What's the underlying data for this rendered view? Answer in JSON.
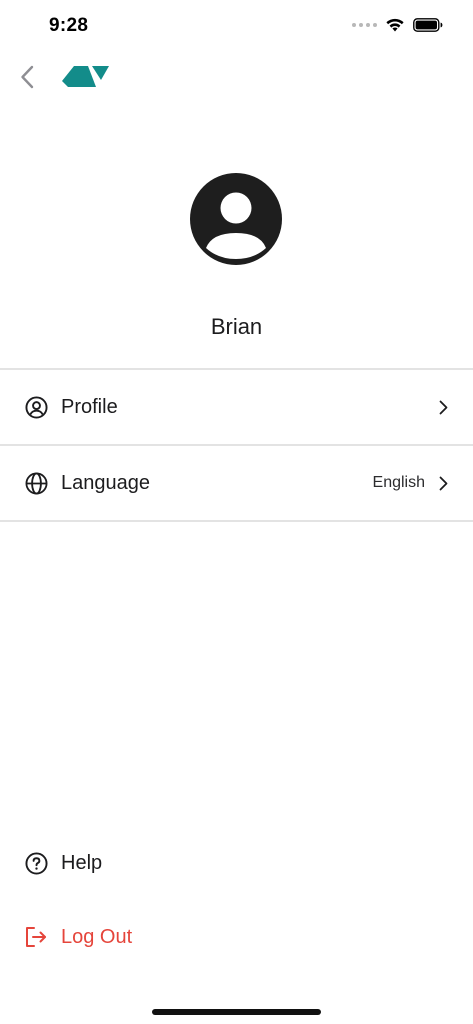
{
  "status_bar": {
    "time": "9:28"
  },
  "nav": {
    "brand_color": "#138c8a"
  },
  "profile": {
    "name": "Brian"
  },
  "menu": {
    "items": [
      {
        "label": "Profile",
        "value": "",
        "icon": "user-circle-icon"
      },
      {
        "label": "Language",
        "value": "English",
        "icon": "globe-icon"
      }
    ]
  },
  "bottom": {
    "help_label": "Help",
    "logout_label": "Log Out",
    "logout_color": "#e5453b"
  }
}
